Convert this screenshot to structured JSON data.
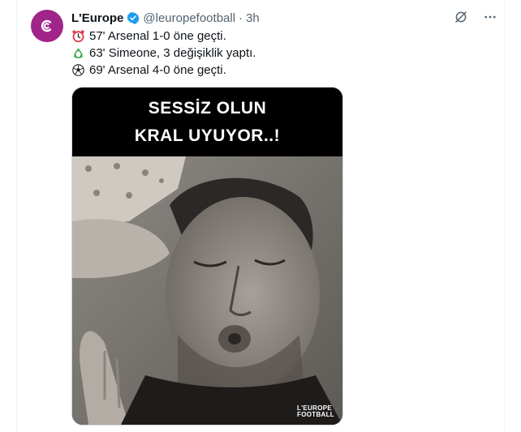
{
  "author": {
    "display_name": "L'Europe",
    "handle": "@leuropefootball",
    "separator": "·",
    "time": "3h",
    "avatar_color": "#a1248a",
    "verified_color": "#1d9bf0"
  },
  "actions": {
    "grok_icon": "grok-icon",
    "more_icon": "more-icon"
  },
  "tweet": {
    "lines": [
      {
        "icon": "alarm-clock",
        "text": "57' Arsenal 1-0 öne geçti."
      },
      {
        "icon": "recycle",
        "text": "63' Simeone, 3 değişiklik yaptı."
      },
      {
        "icon": "soccer-ball",
        "text": "69' Arsenal 4-0 öne geçti."
      }
    ]
  },
  "media": {
    "caption_line1": "SESSİZ OLUN",
    "caption_line2": "KRAL UYUYOR..!",
    "watermark_line1": "L'EUROPE",
    "watermark_line2": "FOOTBALL"
  }
}
